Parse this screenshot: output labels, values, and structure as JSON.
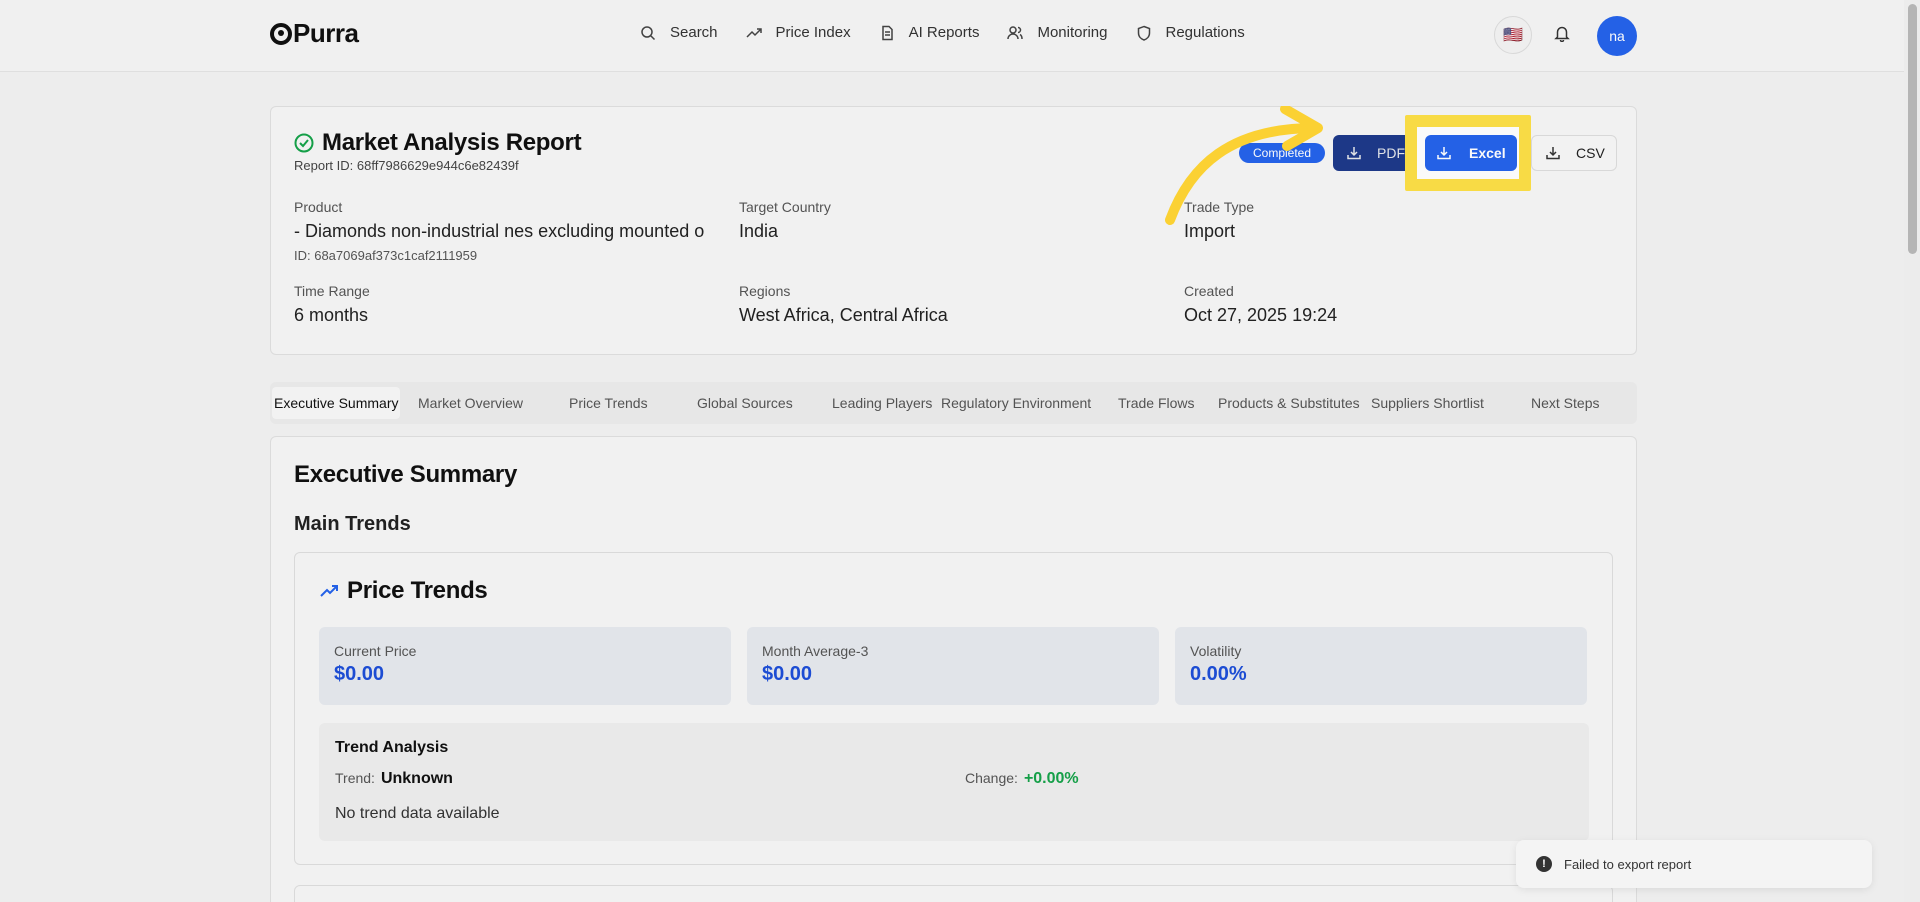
{
  "nav": {
    "logo": "Purra",
    "items": [
      {
        "label": "Search",
        "icon": "search-icon"
      },
      {
        "label": "Price Index",
        "icon": "trending-up-icon"
      },
      {
        "label": "AI Reports",
        "icon": "document-icon"
      },
      {
        "label": "Monitoring",
        "icon": "users-icon"
      },
      {
        "label": "Regulations",
        "icon": "shield-icon"
      }
    ],
    "flag": "🇺🇸",
    "avatar": "na"
  },
  "report": {
    "title": "Market Analysis Report",
    "report_id": "Report ID: 68ff7986629e944c6e82439f",
    "status": "Completed",
    "buttons": {
      "pdf": "PDF",
      "excel": "Excel",
      "csv": "CSV"
    },
    "fields": {
      "product_label": "Product",
      "product_value": "- Diamonds non-industrial nes excluding mounted o",
      "product_id": "ID: 68a7069af373c1caf2111959",
      "country_label": "Target Country",
      "country_value": "India",
      "trade_label": "Trade Type",
      "trade_value": "Import",
      "time_label": "Time Range",
      "time_value": "6 months",
      "regions_label": "Regions",
      "regions_value": "West Africa, Central Africa",
      "created_label": "Created",
      "created_value": "Oct 27, 2025 19:24"
    }
  },
  "tabs": [
    "Executive Summary",
    "Market Overview",
    "Price Trends",
    "Global Sources",
    "Leading Players",
    "Regulatory Environment",
    "Trade Flows",
    "Products & Substitutes",
    "Suppliers Shortlist",
    "Next Steps"
  ],
  "content": {
    "heading": "Executive Summary",
    "subheading": "Main Trends",
    "price_trends": {
      "title": "Price Trends",
      "metrics": [
        {
          "label": "Current Price",
          "value": "$0.00"
        },
        {
          "label": "Month Average-3",
          "value": "$0.00"
        },
        {
          "label": "Volatility",
          "value": "0.00%"
        }
      ],
      "trend_analysis": {
        "title": "Trend Analysis",
        "trend_label": "Trend:",
        "trend_value": "Unknown",
        "change_label": "Change:",
        "change_value": "+0.00%",
        "note": "No trend data available"
      }
    }
  },
  "toast": {
    "message": "Failed to export report"
  },
  "colors": {
    "accent": "#2563eb",
    "highlight": "#fde047",
    "positive": "#16a34a",
    "dark_button": "#1e3a8a"
  }
}
